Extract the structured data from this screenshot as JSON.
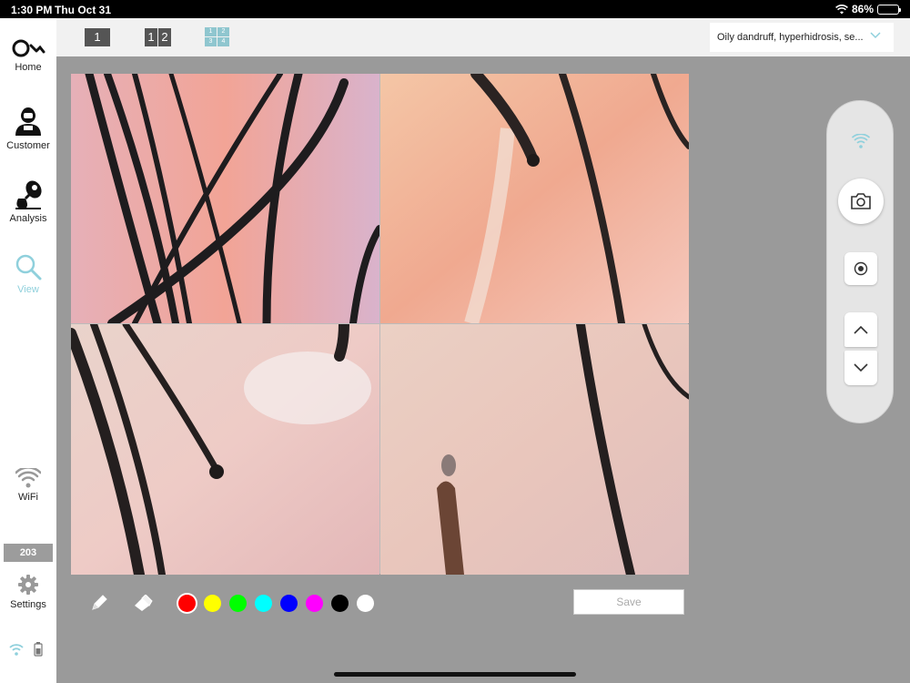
{
  "status_bar": {
    "time": "1:30 PM",
    "date": "Thu Oct 31",
    "battery": "86%",
    "battery_level": 0.86
  },
  "sidebar": {
    "items": [
      {
        "label": "Home",
        "icon": "logo-icon"
      },
      {
        "label": "Customer",
        "icon": "customer-icon"
      },
      {
        "label": "Analysis",
        "icon": "microscope-icon"
      },
      {
        "label": "View",
        "icon": "search-icon",
        "active": true
      },
      {
        "label": "WiFi",
        "icon": "wifi-icon"
      },
      {
        "label": "Settings",
        "icon": "gear-icon"
      }
    ],
    "counter": "203",
    "accent_color": "#8fd0dc"
  },
  "toolbar": {
    "layout_single": [
      "1"
    ],
    "layout_double": [
      "1",
      "2"
    ],
    "layout_quad": [
      "1",
      "2",
      "3",
      "4"
    ],
    "dropdown_value": "Oily dandruff, hyperhidrosis, se..."
  },
  "draw_tools": {
    "colors": [
      "#ff0000",
      "#ffff00",
      "#00ff00",
      "#00ffff",
      "#0000ff",
      "#ff00ff",
      "#000000",
      "#ffffff"
    ],
    "selected_color": "#ff0000",
    "save_label": "Save"
  },
  "camera_controls": {
    "icons": [
      "wifi-icon",
      "camera-icon",
      "record-icon",
      "chevron-up-icon",
      "chevron-down-icon"
    ]
  }
}
